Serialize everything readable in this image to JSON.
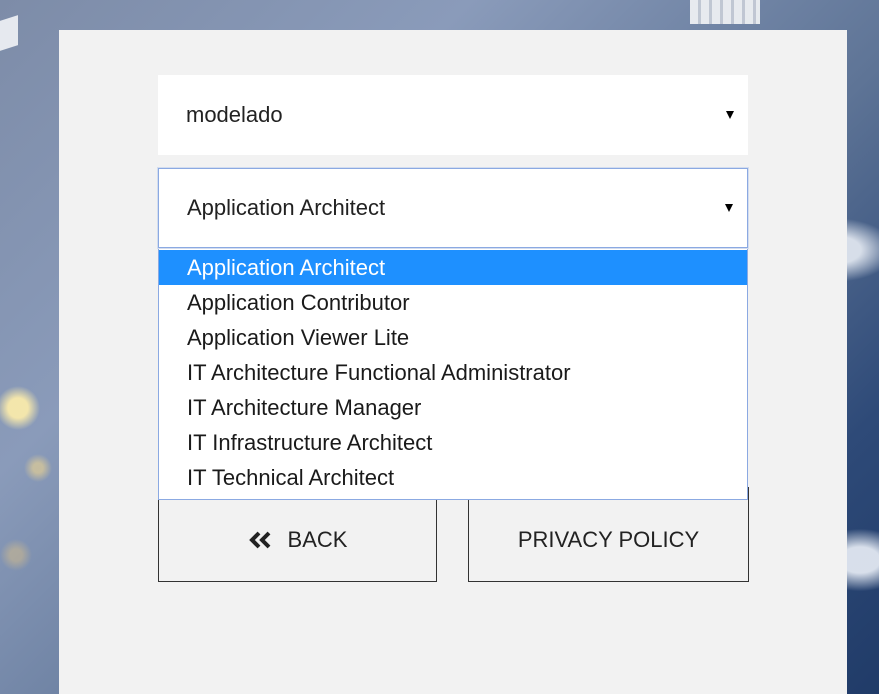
{
  "form": {
    "first_select": {
      "value": "modelado"
    },
    "role_select": {
      "value": "Application Architect",
      "options": [
        "Application Architect",
        "Application Contributor",
        "Application Viewer Lite",
        "IT Architecture Functional Administrator",
        "IT Architecture Manager",
        "IT Infrastructure Architect",
        "IT Technical Architect"
      ],
      "highlighted_index": 0
    }
  },
  "buttons": {
    "back_label": "BACK",
    "privacy_label": "PRIVACY POLICY"
  },
  "icons": {
    "back": "double-chevron-left-icon",
    "select_caret": "caret-down-icon"
  },
  "colors": {
    "highlight": "#1e90ff",
    "panel": "#f2f2f2",
    "focus_border": "#8ba9e2"
  }
}
